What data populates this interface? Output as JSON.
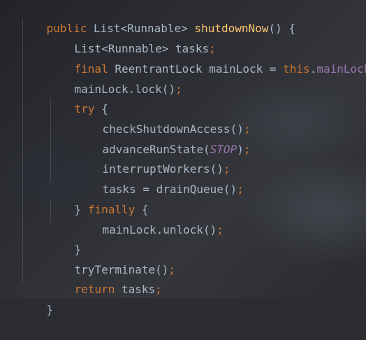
{
  "code": {
    "l1": {
      "kw": "public ",
      "type": "List<Runnable> ",
      "fn": "shutdownNow",
      "rest": "() {"
    },
    "l2": {
      "text": "List<Runnable> tasks",
      "semi": ";"
    },
    "l3": {
      "kw": "final ",
      "plain": "ReentrantLock mainLock = ",
      "this": "this",
      "dot": ".",
      "field": "mainLock",
      "semi": ";"
    },
    "l4": {
      "text": "mainLock.lock()",
      "semi": ";"
    },
    "l5": {
      "kw": "try",
      "rest": " {"
    },
    "l6": {
      "text": "checkShutdownAccess()",
      "semi": ";"
    },
    "l7": {
      "text": "advanceRunState(",
      "stat": "STOP",
      "close": ")",
      "semi": ";"
    },
    "l8": {
      "text": "interruptWorkers()",
      "semi": ";"
    },
    "l9": {
      "text": "tasks = drainQueue()",
      "semi": ";"
    },
    "l10": {
      "brace": "} ",
      "kw": "finally",
      "rest": " {"
    },
    "l11": {
      "text": "mainLock.unlock()",
      "semi": ";"
    },
    "l12": {
      "text": "}"
    },
    "l13": {
      "text": "tryTerminate()",
      "semi": ";"
    },
    "l14": {
      "kw": "return ",
      "text": "tasks",
      "semi": ";"
    },
    "l15": {
      "text": "}"
    }
  },
  "colors": {
    "background": "#2b2d33",
    "keyword": "#cc7832",
    "function": "#ffc66d",
    "field": "#9876aa",
    "text": "#a9b7c6"
  }
}
